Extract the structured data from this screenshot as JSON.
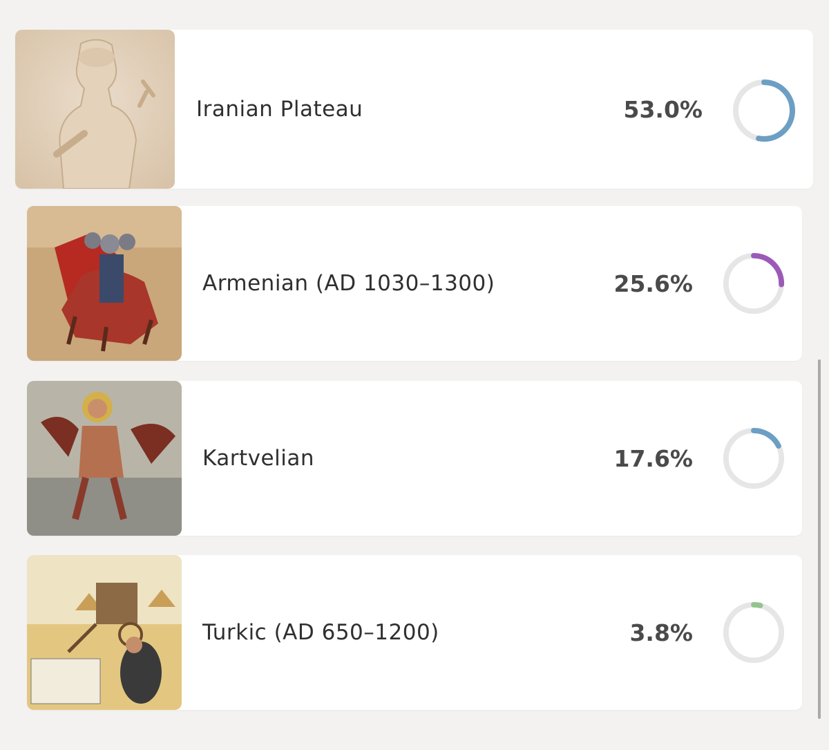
{
  "rows": [
    {
      "label": "Iranian Plateau",
      "percent_text": "53.0%",
      "percent": 53.0,
      "ring_color": "#6c9fc3",
      "thumbnail": "sasanian-seal-relief-image"
    },
    {
      "label": "Armenian (AD 1030–1300)",
      "percent_text": "25.6%",
      "percent": 25.6,
      "ring_color": "#9b5ab8",
      "thumbnail": "armenian-manuscript-horseman-image"
    },
    {
      "label": "Kartvelian",
      "percent_text": "17.6%",
      "percent": 17.6,
      "ring_color": "#6c9fc3",
      "thumbnail": "georgian-fresco-saint-image"
    },
    {
      "label": "Turkic (AD 650–1200)",
      "percent_text": "3.8%",
      "percent": 3.8,
      "ring_color": "#93c38d",
      "thumbnail": "turkic-nomad-camp-illustration-image"
    }
  ],
  "ring_track_color": "#e6e6e6"
}
